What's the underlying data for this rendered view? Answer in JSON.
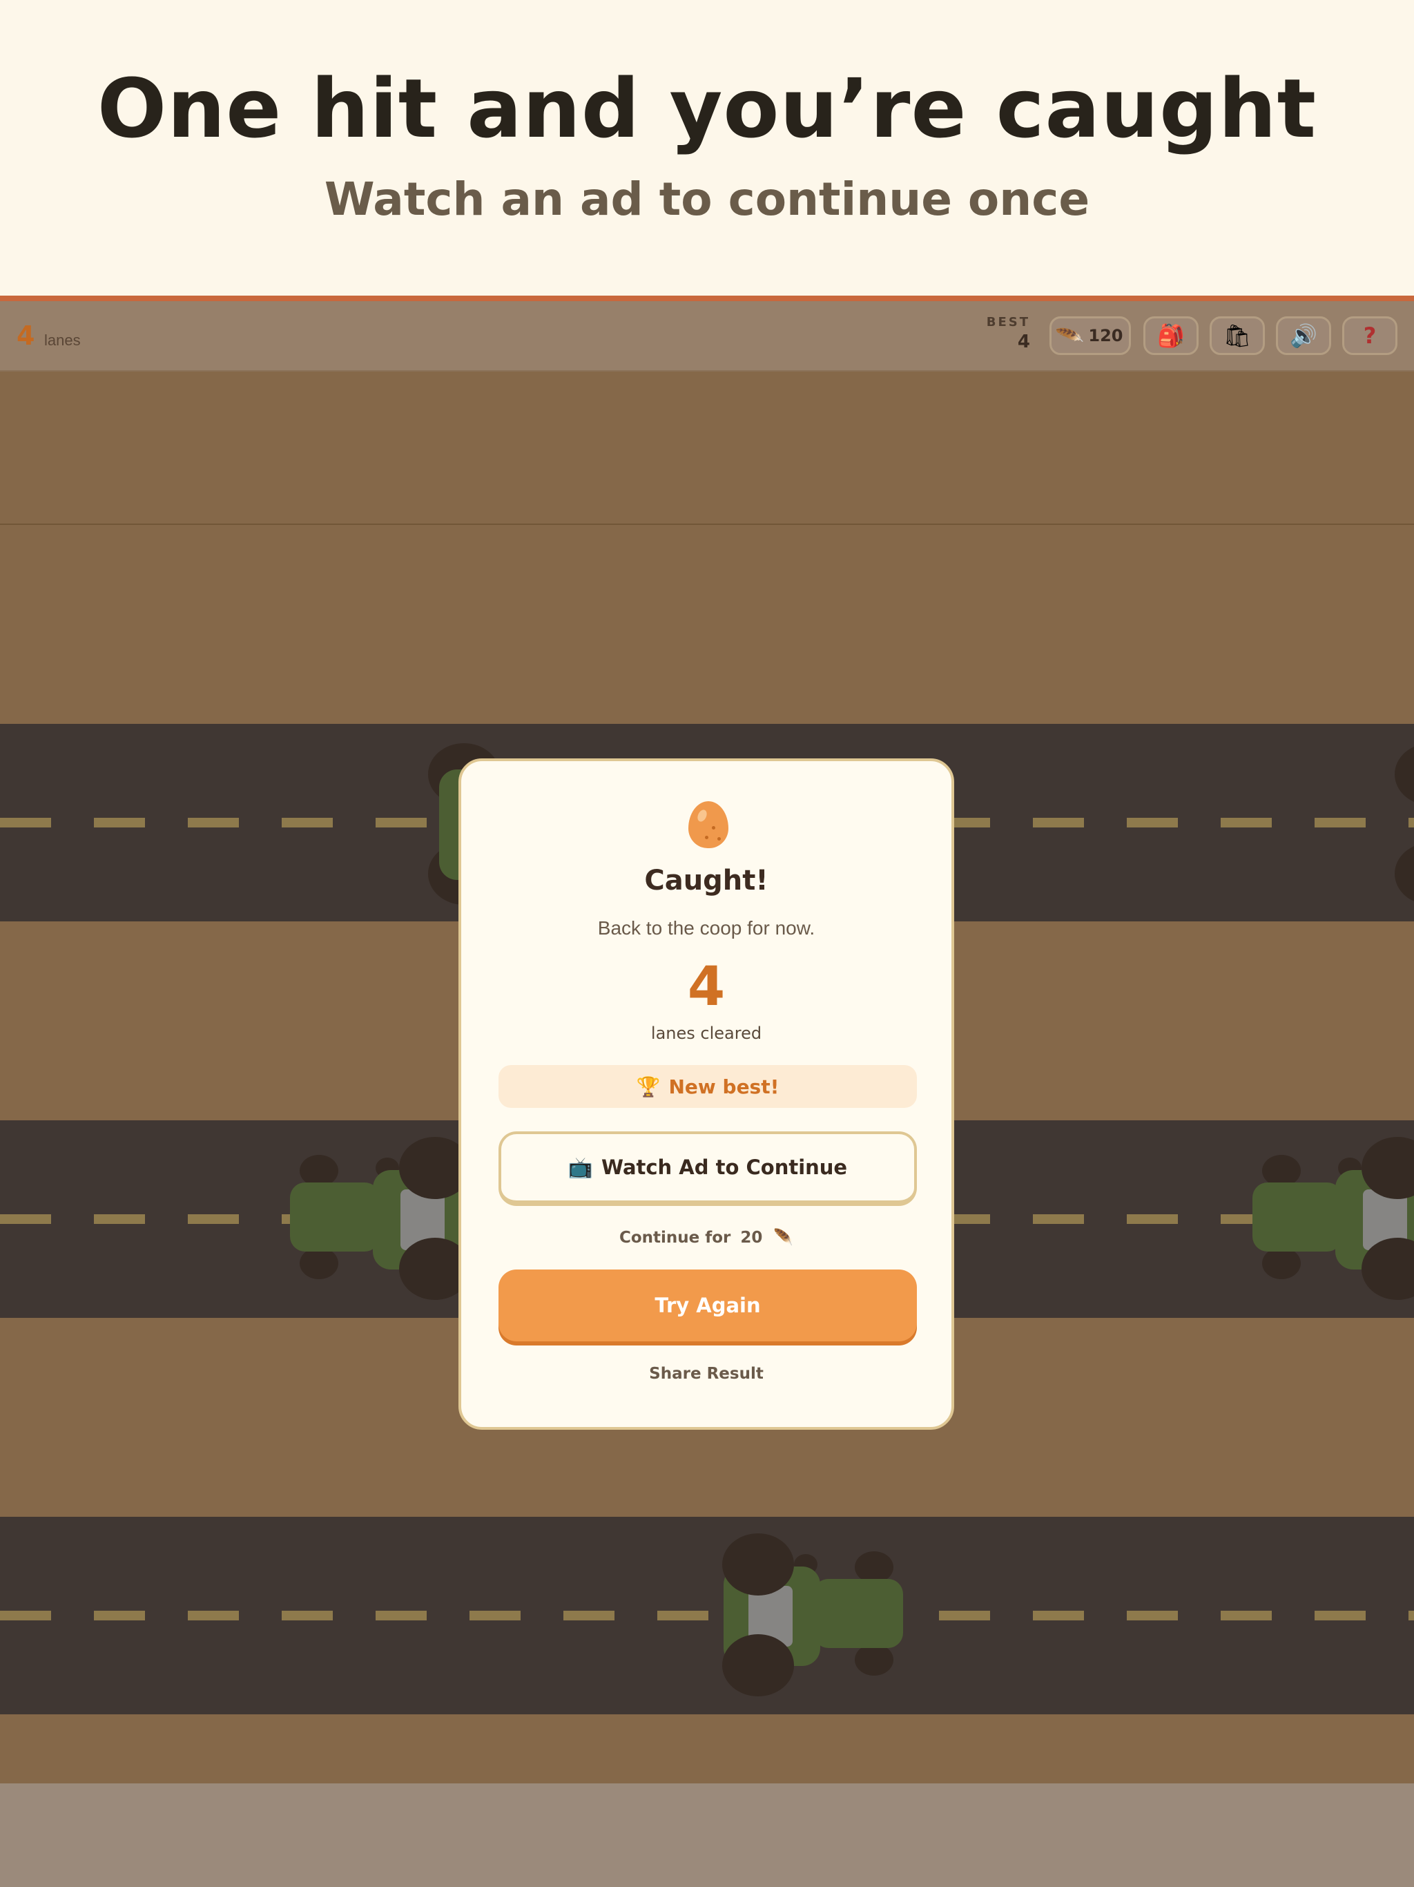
{
  "promo": {
    "title": "One hit and you’re caught",
    "subtitle": "Watch an ad to continue once"
  },
  "hud": {
    "lanes_value": "4",
    "lanes_label": "lanes",
    "best_label": "BEST",
    "best_value": "4",
    "feathers": "120",
    "icons": [
      "feather-icon",
      "backpack-icon",
      "shopping-bag-icon",
      "speaker-icon",
      "question-icon"
    ]
  },
  "modal": {
    "title": "Caught!",
    "message": "Back to the coop for now.",
    "score": "4",
    "score_label": "lanes cleared",
    "best_badge": "New best!",
    "watch_button": "Watch Ad to Continue",
    "continue_text": "Continue for",
    "continue_cost": "20",
    "retry_button": "Try Again",
    "share_link": "Share Result"
  },
  "colors": {
    "accent": "#f29a4b",
    "score": "#d07124",
    "grass": "#856849",
    "road": "#403733"
  }
}
